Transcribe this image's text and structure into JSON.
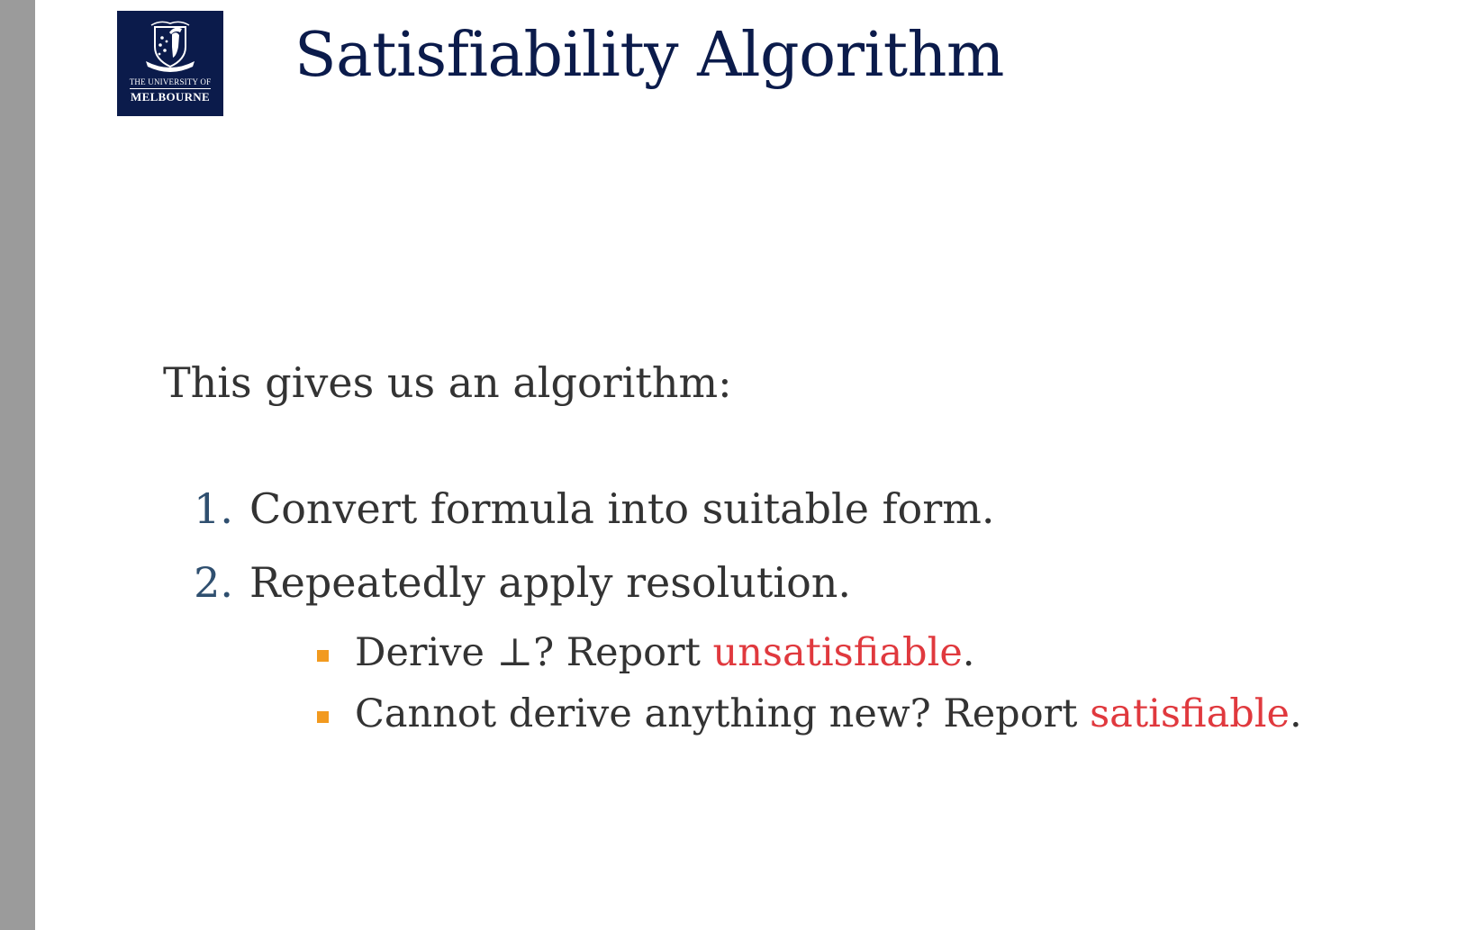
{
  "logo": {
    "line1": "THE UNIVERSITY OF",
    "line2": "MELBOURNE",
    "bg_color": "#0b1b4b"
  },
  "title": "Satisfiability Algorithm",
  "intro": "This gives us an algorithm:",
  "steps": [
    {
      "number": "1.",
      "text": "Convert formula into suitable form."
    },
    {
      "number": "2.",
      "text": "Repeatedly apply resolution."
    }
  ],
  "sub_items": [
    {
      "prefix": "Derive ⊥?  Report ",
      "highlight": "unsatisfiable",
      "suffix": "."
    },
    {
      "prefix": "Cannot derive anything new?  Report ",
      "highlight": "satisfiable",
      "suffix": "."
    }
  ],
  "colors": {
    "title": "#0b1b4b",
    "highlight": "#e0393e",
    "bullet": "#f29a1f",
    "number": "#2f4f6f",
    "side_bar": "#9b9b9b"
  }
}
